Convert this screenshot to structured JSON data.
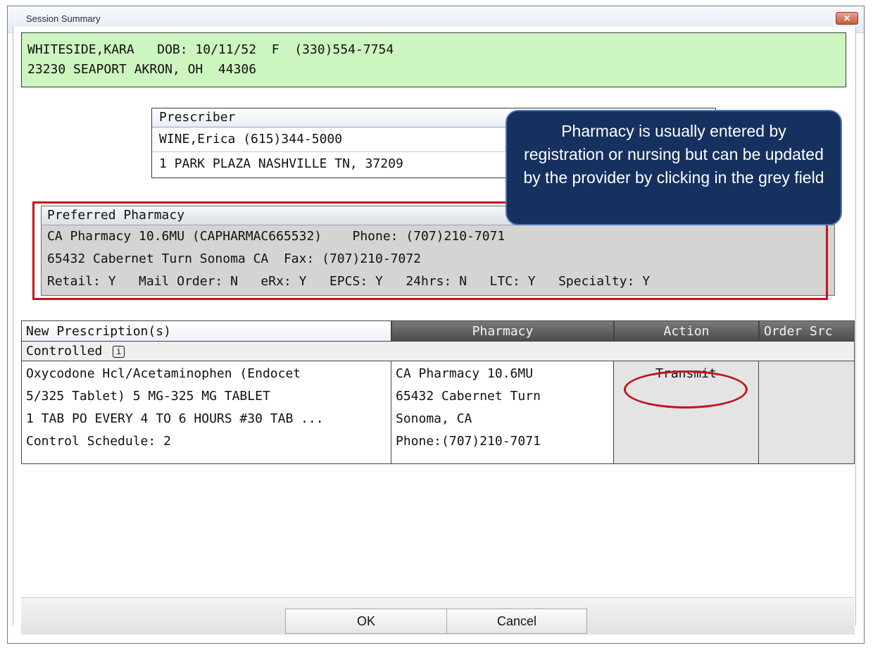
{
  "window": {
    "title": "Session Summary",
    "close_glyph": "✕"
  },
  "patient": {
    "line1": "WHITESIDE,KARA   DOB: 10/11/52  F  (330)554-7754",
    "line2": "23230 SEAPORT AKRON, OH  44306"
  },
  "prescriber": {
    "header": "Prescriber",
    "line1": "WINE,Erica (615)344-5000",
    "line2": "1 PARK PLAZA NASHVILLE TN, 37209"
  },
  "callout": {
    "text": "Pharmacy is usually entered by registration or nursing but can be updated by the provider by clicking in the grey field"
  },
  "pharmacy": {
    "header": "Preferred Pharmacy",
    "line1": "CA Pharmacy 10.6MU (CAPHARMAC665532)    Phone: (707)210-7071",
    "line2": "65432 Cabernet Turn Sonoma CA  Fax: (707)210-7072",
    "line3": "Retail: Y   Mail Order: N   eRx: Y   EPCS: Y   24hrs: N   LTC: Y   Specialty: Y"
  },
  "prescriptions": {
    "columns": {
      "new": "New Prescription(s)",
      "pharmacy": "Pharmacy",
      "action": "Action",
      "order_src": "Order Src"
    },
    "group_label": "Controlled",
    "info_glyph": "i",
    "rows": [
      {
        "drug_lines": [
          "Oxycodone Hcl/Acetaminophen (Endocet",
          "5/325 Tablet) 5 MG-325 MG TABLET",
          "1 TAB PO EVERY 4 TO 6 HOURS #30 TAB ...",
          "Control Schedule: 2"
        ],
        "pharmacy_lines": [
          "CA Pharmacy 10.6MU",
          "65432 Cabernet Turn",
          "Sonoma, CA",
          "Phone:(707)210-7071"
        ],
        "action": "Transmit",
        "order_src": ""
      }
    ]
  },
  "buttons": {
    "ok": "OK",
    "cancel": "Cancel"
  }
}
